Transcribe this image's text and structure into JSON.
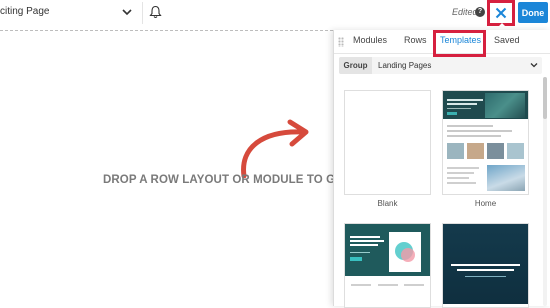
{
  "header": {
    "page_name": "citing Page",
    "edited_label": "Edited",
    "help_glyph": "?",
    "done_label": "Done",
    "close_glyph": "✕"
  },
  "canvas": {
    "empty_message": "DROP A ROW LAYOUT OR MODULE TO GET S"
  },
  "panel": {
    "tabs": [
      {
        "label": "Modules",
        "active": false
      },
      {
        "label": "Rows",
        "active": false
      },
      {
        "label": "Templates",
        "active": true
      },
      {
        "label": "Saved",
        "active": false
      }
    ],
    "group": {
      "label": "Group",
      "value": "Landing Pages"
    },
    "templates": [
      {
        "name": "Blank"
      },
      {
        "name": "Home"
      },
      {
        "name": ""
      },
      {
        "name": ""
      }
    ]
  },
  "colors": {
    "accent": "#1b86d8",
    "highlight": "#d6203f",
    "arrow": "#d64a3c"
  },
  "icons": {
    "chevron": "chevron-down-icon",
    "bell": "bell-icon",
    "help": "help-icon",
    "close": "close-icon",
    "arrow": "curved-arrow-icon"
  }
}
